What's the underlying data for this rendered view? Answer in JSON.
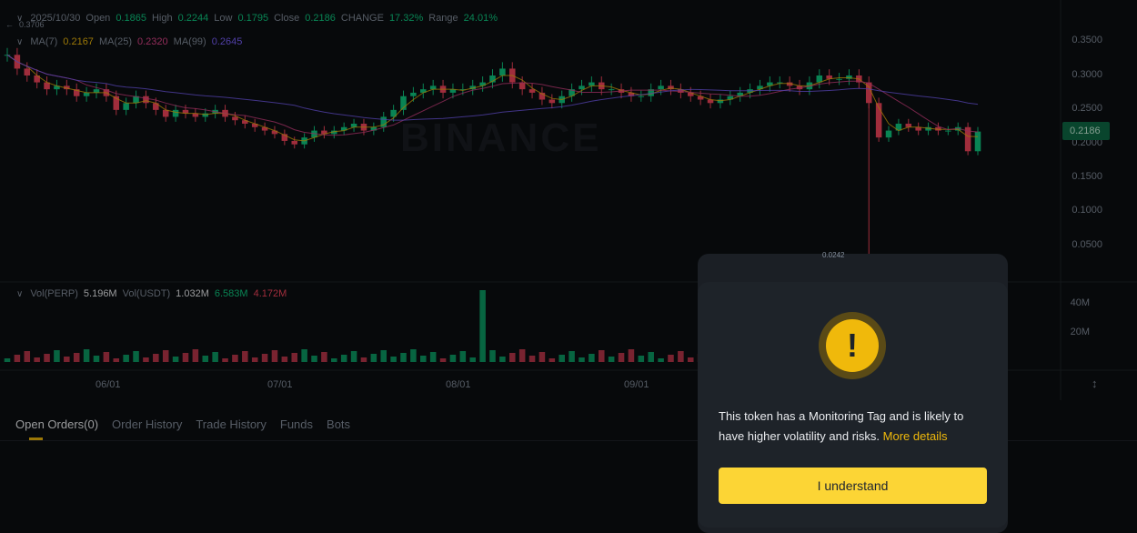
{
  "ohlc_legend": {
    "date": "2025/10/30",
    "open_label": "Open",
    "open": "0.1865",
    "high_label": "High",
    "high": "0.2244",
    "low_label": "Low",
    "low": "0.1795",
    "close_label": "Close",
    "close": "0.2186",
    "change_label": "CHANGE",
    "change": "17.32%",
    "range_label": "Range",
    "range": "24.01%"
  },
  "ma_legend": {
    "ma7_label": "MA(7)",
    "ma7": "0.2167",
    "ma25_label": "MA(25)",
    "ma25": "0.2320",
    "ma99_label": "MA(99)",
    "ma99": "0.2645"
  },
  "vol_legend": {
    "vol_perp_label": "Vol(PERP)",
    "vol_perp": "5.196M",
    "vol_usdt_label": "Vol(USDT)",
    "vol_usdt": "1.032M",
    "vol_a": "6.583M",
    "vol_b": "4.172M"
  },
  "high_marker": "0.3706",
  "low_marker": "0.0242",
  "current_price": "0.2186",
  "watermark": "BINANCE",
  "colors": {
    "up": "#0ecb81",
    "down": "#f6465d",
    "accent": "#f0b90b",
    "ma7": "#f0b90b",
    "ma25": "#e0458b",
    "ma99": "#7b61ff"
  },
  "chart_data": {
    "type": "candlestick",
    "x_ticks": [
      "06/01",
      "07/01",
      "08/01",
      "09/01"
    ],
    "price_axis": [
      "0.3500",
      "0.3000",
      "0.2500",
      "0.2000",
      "0.1500",
      "0.1000",
      "0.0500"
    ],
    "volume_axis": [
      "40M",
      "20M"
    ],
    "price_range": [
      0.02,
      0.37
    ],
    "series_close": [
      0.33,
      0.31,
      0.3,
      0.29,
      0.28,
      0.285,
      0.28,
      0.27,
      0.275,
      0.28,
      0.27,
      0.25,
      0.26,
      0.27,
      0.26,
      0.25,
      0.24,
      0.25,
      0.245,
      0.24,
      0.245,
      0.25,
      0.24,
      0.235,
      0.23,
      0.225,
      0.22,
      0.215,
      0.205,
      0.2,
      0.21,
      0.22,
      0.215,
      0.22,
      0.225,
      0.23,
      0.22,
      0.225,
      0.24,
      0.25,
      0.27,
      0.275,
      0.28,
      0.285,
      0.275,
      0.28,
      0.28,
      0.285,
      0.29,
      0.3,
      0.31,
      0.29,
      0.28,
      0.275,
      0.265,
      0.26,
      0.27,
      0.28,
      0.285,
      0.29,
      0.28,
      0.28,
      0.275,
      0.27,
      0.27,
      0.28,
      0.285,
      0.28,
      0.275,
      0.27,
      0.265,
      0.26,
      0.265,
      0.27,
      0.275,
      0.28,
      0.285,
      0.29,
      0.29,
      0.285,
      0.28,
      0.29,
      0.3,
      0.295,
      0.295,
      0.3,
      0.29,
      0.26,
      0.21,
      0.22,
      0.23,
      0.225,
      0.22,
      0.225,
      0.22,
      0.22,
      0.225,
      0.19,
      0.2186
    ]
  },
  "tabs": [
    {
      "label": "Open Orders(0)"
    },
    {
      "label": "Order History"
    },
    {
      "label": "Trade History"
    },
    {
      "label": "Funds"
    },
    {
      "label": "Bots"
    }
  ],
  "modal": {
    "message": "This token has a Monitoring Tag and is likely to have higher volatility and risks.",
    "link": "More details",
    "button": "I understand"
  }
}
